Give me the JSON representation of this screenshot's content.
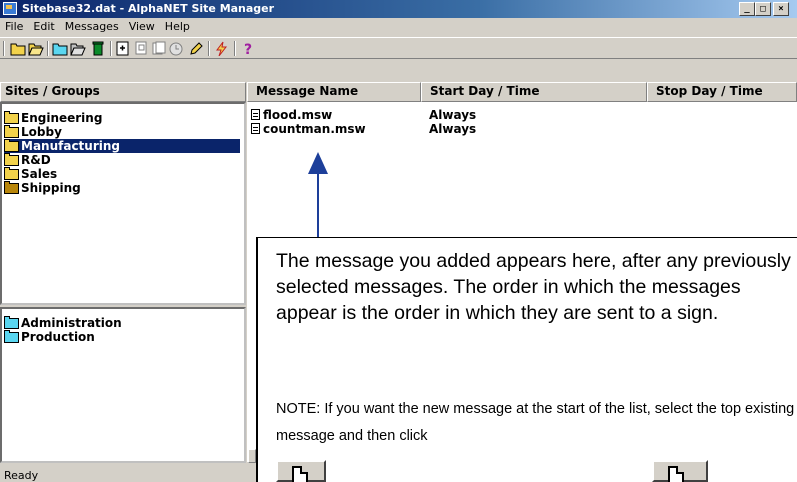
{
  "window": {
    "title": "Sitebase32.dat - AlphaNET Site Manager",
    "caption_buttons": {
      "minimize": "_",
      "maximize": "□",
      "close": "×"
    }
  },
  "menu": [
    "File",
    "Edit",
    "Messages",
    "View",
    "Help"
  ],
  "toolbar": {
    "icons": [
      "new-folder-icon",
      "open-folder-icon",
      "folder-icon",
      "open-folder-2-icon",
      "trash-icon",
      "add-message-icon",
      "copy-icon",
      "paste-icon",
      "schedule-icon",
      "edit-pencil-icon",
      "send-lightning-icon",
      "help-icon"
    ]
  },
  "sites_pane": {
    "header": "Sites / Groups",
    "items": [
      {
        "label": "Engineering",
        "selected": false,
        "icon_color": "#f2d24b"
      },
      {
        "label": "Lobby",
        "selected": false,
        "icon_color": "#f2d24b"
      },
      {
        "label": "Manufacturing",
        "selected": true,
        "icon_color": "#f2d24b"
      },
      {
        "label": "R&D",
        "selected": false,
        "icon_color": "#f2d24b"
      },
      {
        "label": "Sales",
        "selected": false,
        "icon_color": "#f2d24b"
      },
      {
        "label": "Shipping",
        "selected": false,
        "icon_color": "#b8860b"
      }
    ]
  },
  "signs_pane": {
    "items": [
      {
        "label": "Administration",
        "icon_color": "#5ad6f0"
      },
      {
        "label": "Production",
        "icon_color": "#5ad6f0"
      }
    ]
  },
  "message_list": {
    "columns": [
      "Message Name",
      "Start Day / Time",
      "Stop Day / Time"
    ],
    "rows": [
      {
        "name": "flood.msw",
        "start": "Always",
        "stop": ""
      },
      {
        "name": "countman.msw",
        "start": "Always",
        "stop": ""
      }
    ]
  },
  "annotation": {
    "main_text": "The message you added appears here, after any previously selected messages. The order in which the messages appear is the order in which they are sent to a sign.",
    "note_text": "NOTE: If you want the new message at the start of the list, select the top existing message and then click",
    "arrow_color": "#1d3f9a"
  },
  "status": "Ready"
}
